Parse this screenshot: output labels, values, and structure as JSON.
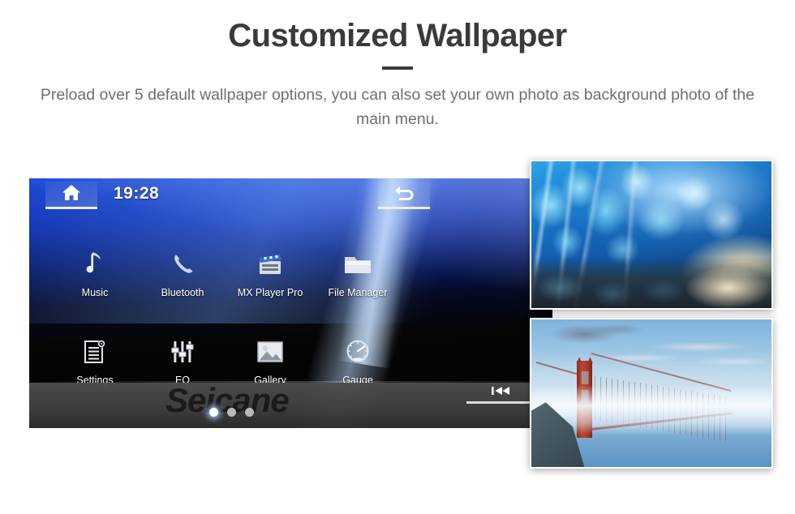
{
  "header": {
    "title": "Customized Wallpaper",
    "subtitle": "Preload over 5 default wallpaper options, you can also set your own photo as background photo of the main menu."
  },
  "head_unit": {
    "clock": "19:28",
    "home_icon": "home-icon",
    "back_icon": "back-arrow-icon",
    "watermark": "Seicane",
    "prev_icon": "previous-track-icon",
    "apps": [
      {
        "label": "Music",
        "icon": "music-note-icon"
      },
      {
        "label": "Bluetooth",
        "icon": "bluetooth-phone-icon"
      },
      {
        "label": "MX Player Pro",
        "icon": "video-clapper-icon"
      },
      {
        "label": "File Manager",
        "icon": "folder-icon"
      },
      {
        "label": "Settings",
        "icon": "settings-document-icon"
      },
      {
        "label": "EQ",
        "icon": "equalizer-sliders-icon"
      },
      {
        "label": "Gallery",
        "icon": "photo-image-icon"
      },
      {
        "label": "Gauge",
        "icon": "speedometer-icon"
      }
    ],
    "page_dots": {
      "count": 3,
      "active_index": 0
    }
  },
  "wallpaper_cards": [
    {
      "name": "ice-cave-wallpaper",
      "alt": "Blue ice cave with sunlight"
    },
    {
      "name": "golden-gate-wallpaper",
      "alt": "Golden Gate Bridge above fog"
    }
  ],
  "colors": {
    "title": "#3a3a3a",
    "subtitle": "#6c6f73",
    "screen_blue": "#1b49d8",
    "screen_black": "#050505",
    "bottom_bar": "#3e3e3e",
    "dot_active": "#ffffff",
    "dot_inactive": "#b9b9b9",
    "page_background": "#ffffff"
  }
}
